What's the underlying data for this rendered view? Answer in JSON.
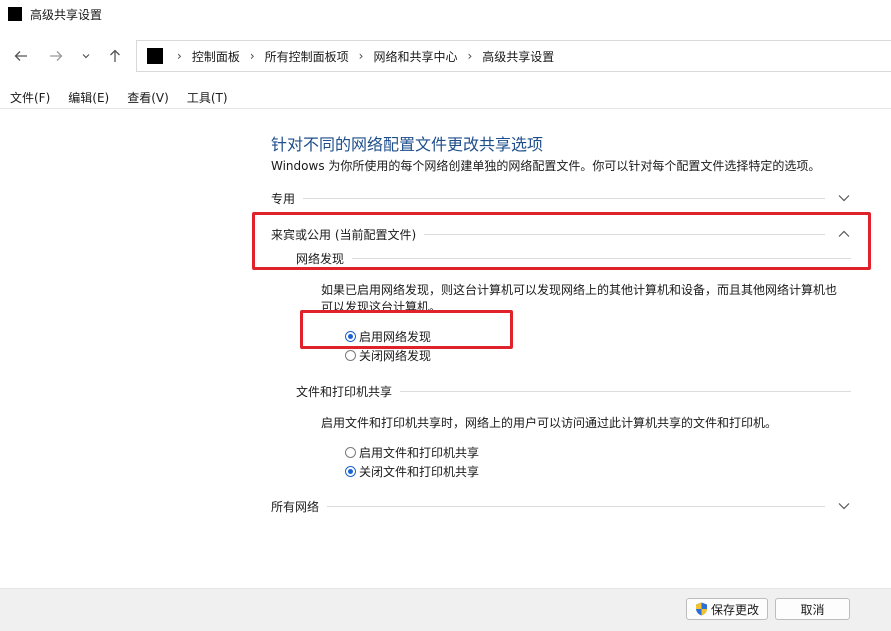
{
  "window": {
    "title": "高级共享设置"
  },
  "nav": {
    "breadcrumbs": [
      "控制面板",
      "所有控制面板项",
      "网络和共享中心",
      "高级共享设置"
    ]
  },
  "menu": [
    "文件(F)",
    "编辑(E)",
    "查看(V)",
    "工具(T)"
  ],
  "content": {
    "title": "针对不同的网络配置文件更改共享选项",
    "intro": "Windows 为你所使用的每个网络创建单独的网络配置文件。你可以针对每个配置文件选择特定的选项。",
    "profiles": {
      "private": {
        "label": "专用",
        "expanded": false
      },
      "guest_public": {
        "label": "来宾或公用 (当前配置文件)",
        "expanded": true,
        "network_discovery": {
          "heading": "网络发现",
          "description": "如果已启用网络发现，则这台计算机可以发现网络上的其他计算机和设备，而且其他网络计算机也可以发现这台计算机。",
          "options": [
            {
              "label": "启用网络发现",
              "selected": true
            },
            {
              "label": "关闭网络发现",
              "selected": false
            }
          ]
        },
        "file_printer_sharing": {
          "heading": "文件和打印机共享",
          "description": "启用文件和打印机共享时，网络上的用户可以访问通过此计算机共享的文件和打印机。",
          "options": [
            {
              "label": "启用文件和打印机共享",
              "selected": false
            },
            {
              "label": "关闭文件和打印机共享",
              "selected": true
            }
          ]
        }
      },
      "all_networks": {
        "label": "所有网络",
        "expanded": false
      }
    }
  },
  "footer": {
    "save_label": "保存更改",
    "cancel_label": "取消"
  },
  "colors": {
    "accent": "#1e63c9",
    "title_blue": "#1e4e8c",
    "highlight_red": "#e0232b"
  },
  "icons": [
    "app-icon",
    "back-arrow-icon",
    "forward-arrow-icon",
    "recent-dropdown-icon",
    "up-arrow-icon",
    "shield-icon",
    "chevron-down-icon",
    "chevron-up-icon"
  ]
}
